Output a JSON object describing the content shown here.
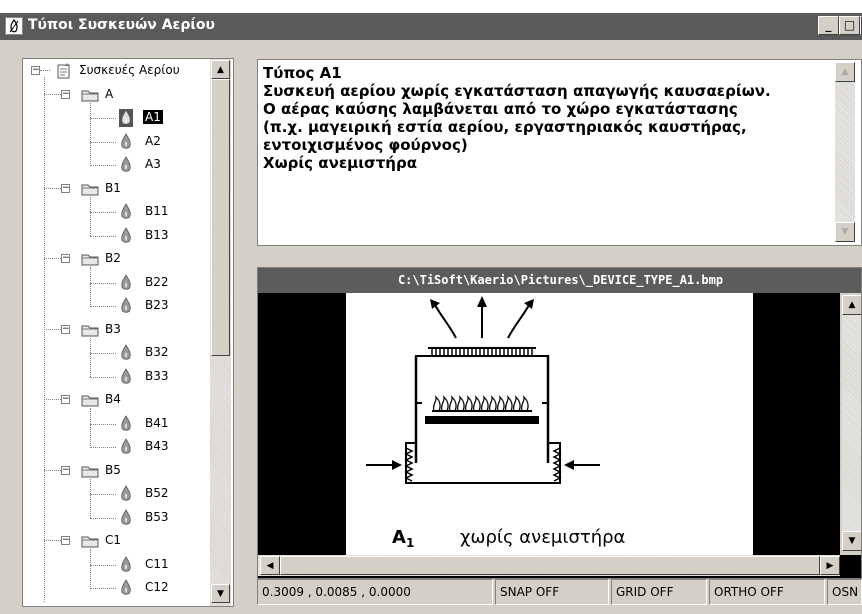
{
  "window": {
    "title": "Τύποι Συσκευών Αερίου",
    "controls": {
      "minimize": "_",
      "maximize": "□",
      "close": "×"
    }
  },
  "tree": {
    "root_label": "Συσκευές Αερίου",
    "groups": [
      {
        "label": "A",
        "items": [
          "A1",
          "A2",
          "A3"
        ]
      },
      {
        "label": "B1",
        "items": [
          "B11",
          "B13"
        ]
      },
      {
        "label": "B2",
        "items": [
          "B22",
          "B23"
        ]
      },
      {
        "label": "B3",
        "items": [
          "B32",
          "B33"
        ]
      },
      {
        "label": "B4",
        "items": [
          "B41",
          "B43"
        ]
      },
      {
        "label": "B5",
        "items": [
          "B52",
          "B53"
        ]
      },
      {
        "label": "C1",
        "items": [
          "C11",
          "C12"
        ]
      }
    ],
    "selected": "A1"
  },
  "description": {
    "lines": [
      "Τύπος A1",
      "Συσκευή αερίου χωρίς εγκατάσταση απαγωγής καυσαερίων.",
      "Ο αέρας καύσης λαμβάνεται από το χώρο εγκατάστασης",
      "(π.χ. μαγειρική εστία αερίου, εργαστηριακός καυστήρας,",
      "εντοιχισμένος φούρνος)",
      "Χωρίς ανεμιστήρα"
    ]
  },
  "image": {
    "path": "C:\\TiSoft\\Kaerio\\Pictures\\_DEVICE_TYPE_A1.bmp",
    "diagram_label_symbol": "A",
    "diagram_label_sub": "1",
    "diagram_label_text": "χωρίς ανεμιστήρα"
  },
  "status": {
    "coords": "0.3009 , 0.0085 , 0.0000",
    "snap": "SNAP OFF",
    "grid": "GRID OFF",
    "ortho": "ORTHO OFF",
    "osnap": "OSN"
  }
}
